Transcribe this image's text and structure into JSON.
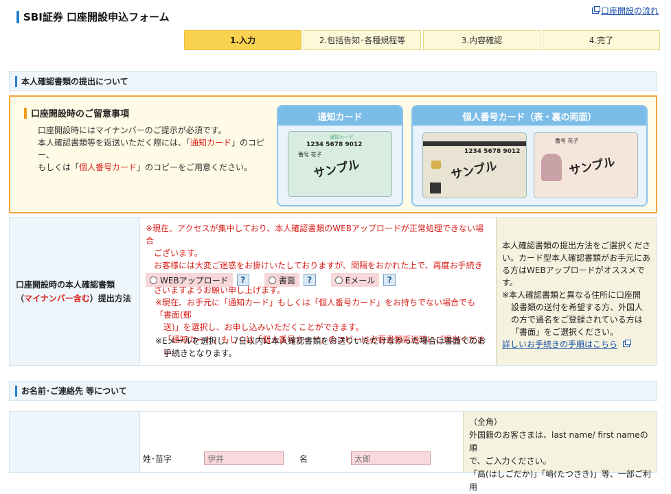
{
  "header": {
    "title": "SBI証券 口座開設申込フォーム",
    "flow_link": "口座開設の流れ"
  },
  "steps": [
    {
      "label": "1.入力",
      "active": true
    },
    {
      "label": "2.包括告知･各種規程等",
      "active": false
    },
    {
      "label": "3.内容確認",
      "active": false
    },
    {
      "label": "4.完了",
      "active": false
    }
  ],
  "section1": {
    "title": "本人確認書類の提出について"
  },
  "notice": {
    "title": "口座開設時のご留意事項",
    "line1": "口座開設時にはマイナンバーのご提示が必須です。",
    "line2a": "本人確認書類等を返送いただく際には、「",
    "line2b": "通知カード",
    "line2c": "」のコピー、",
    "line3a": "もしくは「",
    "line3b": "個人番号カード",
    "line3c": "」のコピーをご用意ください。",
    "card1_title": "通知カード",
    "card2_title": "個人番号カード（表・裏の両面）",
    "sample": "サンプル",
    "card_number": "1234 5678 9012",
    "card_name": "番号 花子",
    "card_label": "通知カード"
  },
  "submission": {
    "label1": "口座開設時の本人確認書類",
    "label2a": "（",
    "label2b": "マイナンバー含む",
    "label2c": "）提出方法",
    "warning1": "※現在、アクセスが集中しており、本人確認書類のWEBアップロードが正常処理できない場合",
    "warning2": "ございます。",
    "warning3": "お客様には大変ご迷惑をお掛けいたしておりますが、間隔をおかれた上で、再度お手続き下",
    "warning4": "さいますようお願い申し上げます。",
    "options": [
      "WEBアップロード",
      "書面",
      "Eメール"
    ],
    "help": "?",
    "note1": "※現在、お手元に「通知カード」もしくは「個人番号カード」をお持ちでない場合でも「書面(郵",
    "note2": "送)」を選択し、お申し込みいただくことができます。",
    "note3": "「通知カード」もしくは「個人番号カード」のコピーは必要書類返送時にご提出ください。",
    "note4": "※Eメールを選択し、7日以内に本人確認書類をお送りいただけなかった場合は書面でのお",
    "note5": "手続きとなります。",
    "side1": "本人確認書類の提出方法をご選択くださ",
    "side2": "い。カード型本人確認書類がお手元にあ",
    "side3": "る方はWEBアップロードがオススメです。",
    "side4": "※本人確認書類と異なる住所に口座開",
    "side5": "設書類の送付を希望する方、外国人",
    "side6": "の方で通名をご登録されている方は",
    "side7": "「書面」をご選択ください。",
    "side_link": "詳しいお手続きの手順はこちら"
  },
  "section2": {
    "title": "お名前･ご連絡先 等について"
  },
  "name_row": {
    "surname_label": "姓･苗字",
    "given_label": "名",
    "surname_value": "伊井",
    "given_value": "太郎",
    "hint1": "（全角）",
    "hint2": "外国籍のお客さまは、last name/ first nameの順",
    "hint3": "で、ご入力ください。",
    "hint4": "「髙(はしごだか)」「﨑(たつさき)」等、一部ご利用"
  }
}
